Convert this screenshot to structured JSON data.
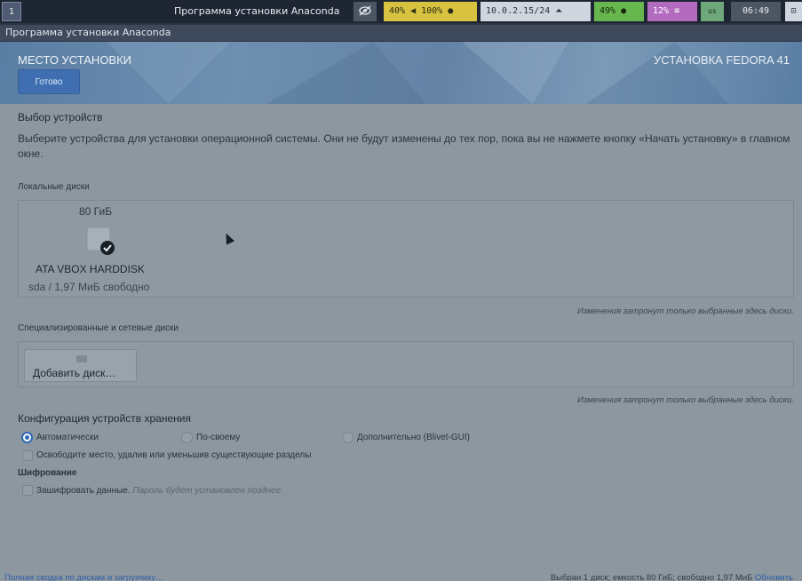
{
  "topbar": {
    "workspace": "1",
    "window_title": "Программа установки Anaconda",
    "audio": "40% ◀ 100% ●",
    "network": "10.0.2.15/24",
    "battery": "49%",
    "cpu": "12% ≡",
    "keyboard": "us",
    "time": "06:49"
  },
  "titlebar": {
    "title": "Программа установки Anaconda"
  },
  "header": {
    "title": "МЕСТО УСТАНОВКИ",
    "done_label": "Готово",
    "product": "УСТАНОВКА FEDORA 41"
  },
  "device_selection": {
    "heading": "Выбор устройств",
    "description": "Выберите устройства для установки операционной системы. Они не будут изменены до тех пор, пока вы не нажмете кнопку «Начать установку» в главном окне."
  },
  "local_disks": {
    "label": "Локальные диски",
    "disks": [
      {
        "size": "80 ГиБ",
        "name": "ATA VBOX HARDDISK",
        "detail": "sda  /  1,97 МиБ свободно"
      }
    ],
    "note": "Изменения затронут только выбранные здесь диски."
  },
  "special_disks": {
    "label": "Специализированные и сетевые диски",
    "add_button": "Добавить диск…",
    "note": "Изменения затронут только выбранные здесь диски."
  },
  "storage_config": {
    "heading": "Конфигурация устройств хранения",
    "options": [
      "Автоматически",
      "По-своему",
      "Дополнительно (Blivet-GUI)"
    ],
    "selected": "Автоматически",
    "reclaim_label": "Освободите место, удалив или уменьшив существующие разделы"
  },
  "encryption": {
    "heading": "Шифрование",
    "encrypt_label": "Зашифровать данные.",
    "encrypt_hint": "Пароль будет установлен позднее."
  },
  "footer": {
    "link": "Полная сводка по дискам и загрузчику…",
    "summary": "Выбран 1 диск; емкость 80 ГиБ; свободно 1,97 МиБ",
    "refresh": "Обновить"
  }
}
